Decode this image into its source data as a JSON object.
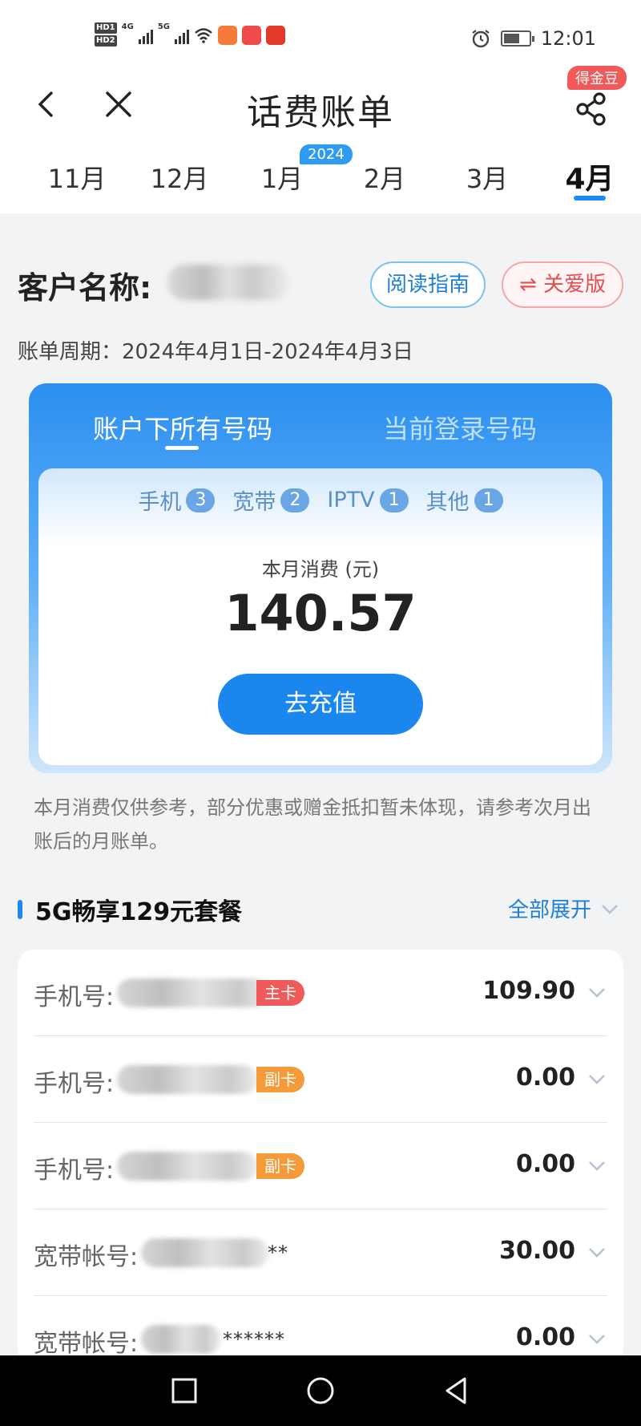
{
  "status_bar": {
    "hd1": "HD",
    "hd1_sub": "1",
    "hd2": "HD",
    "hd2_sub": "2",
    "net1": "4G",
    "net2": "5G",
    "time": "12:01",
    "icons": [
      "signal-icon",
      "signal-icon",
      "wifi-icon",
      "app-icon",
      "app-icon",
      "app-icon",
      "alarm-icon",
      "battery-icon"
    ]
  },
  "header": {
    "title": "话费账单",
    "coin_badge": "得金豆",
    "year_badge": "2024"
  },
  "months": [
    "11月",
    "12月",
    "1月",
    "2月",
    "3月",
    "4月"
  ],
  "active_month_index": 5,
  "customer": {
    "label": "客户名称:",
    "guide_button": "阅读指南",
    "care_button": "⇌ 关爱版",
    "period": "账单周期：2024年4月1日-2024年4月3日"
  },
  "card": {
    "tab_all": "账户下所有号码",
    "tab_current": "当前登录号码",
    "counts": [
      {
        "label": "手机",
        "count": "3"
      },
      {
        "label": "宽带",
        "count": "2"
      },
      {
        "label": "IPTV",
        "count": "1"
      },
      {
        "label": "其他",
        "count": "1"
      }
    ],
    "month_consumption_label": "本月消费 (元)",
    "amount": "140.57",
    "recharge_button": "去充值"
  },
  "note": "本月消费仅供参考，部分优惠或赠金抵扣暂未体现，请参考次月出账后的月账单。",
  "package": {
    "title": "5G畅享129元套餐",
    "expand_all": "全部展开",
    "rows": [
      {
        "label": "手机号:",
        "tag": "主卡",
        "value": "109.90"
      },
      {
        "label": "手机号:",
        "tag": "副卡",
        "value": "0.00"
      },
      {
        "label": "手机号:",
        "tag": "副卡",
        "value": "0.00"
      },
      {
        "label": "宽带帐号:",
        "suffix": "**",
        "value": "30.00"
      },
      {
        "label": "宽带帐号:",
        "suffix": "******",
        "value": "0.00"
      }
    ]
  },
  "colors": {
    "accent": "#1e88ef",
    "card_top": "#2b8ff0",
    "main_tag": "#ef5a5a",
    "sub_tag": "#f59a38"
  }
}
